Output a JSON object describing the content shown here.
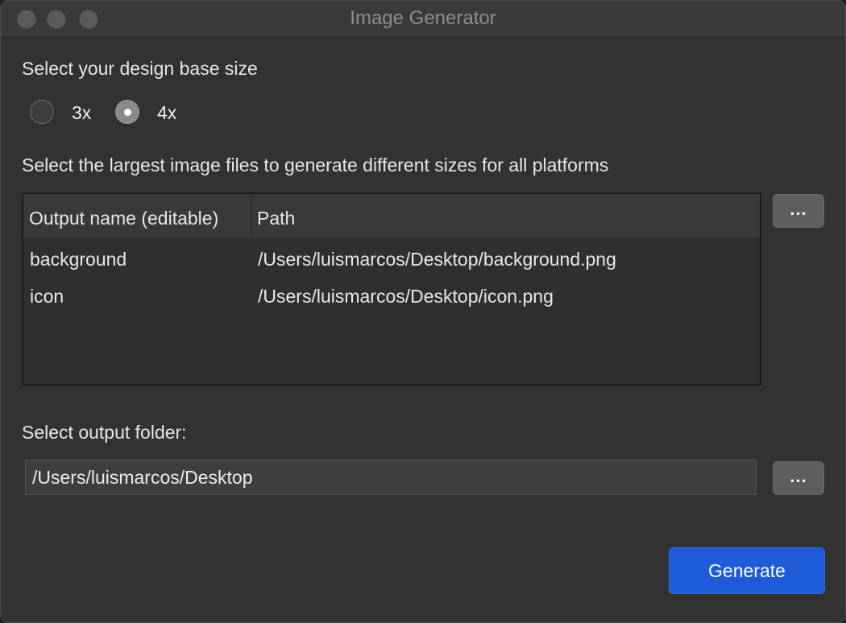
{
  "window": {
    "title": "Image Generator"
  },
  "base_size": {
    "label": "Select your design base size",
    "options": [
      {
        "label": "3x",
        "selected": false
      },
      {
        "label": "4x",
        "selected": true
      }
    ]
  },
  "files": {
    "label": "Select the largest image files to generate different sizes for all platforms",
    "columns": [
      "Output name (editable)",
      "Path"
    ],
    "rows": [
      {
        "name": "background",
        "path": "/Users/luismarcos/Desktop/background.png"
      },
      {
        "name": "icon",
        "path": "/Users/luismarcos/Desktop/icon.png"
      }
    ],
    "browse_label": "..."
  },
  "output": {
    "label": "Select output folder:",
    "value": "/Users/luismarcos/Desktop",
    "browse_label": "..."
  },
  "actions": {
    "generate_label": "Generate"
  },
  "colors": {
    "accent": "#1d5bd8",
    "window_bg": "#323232"
  }
}
